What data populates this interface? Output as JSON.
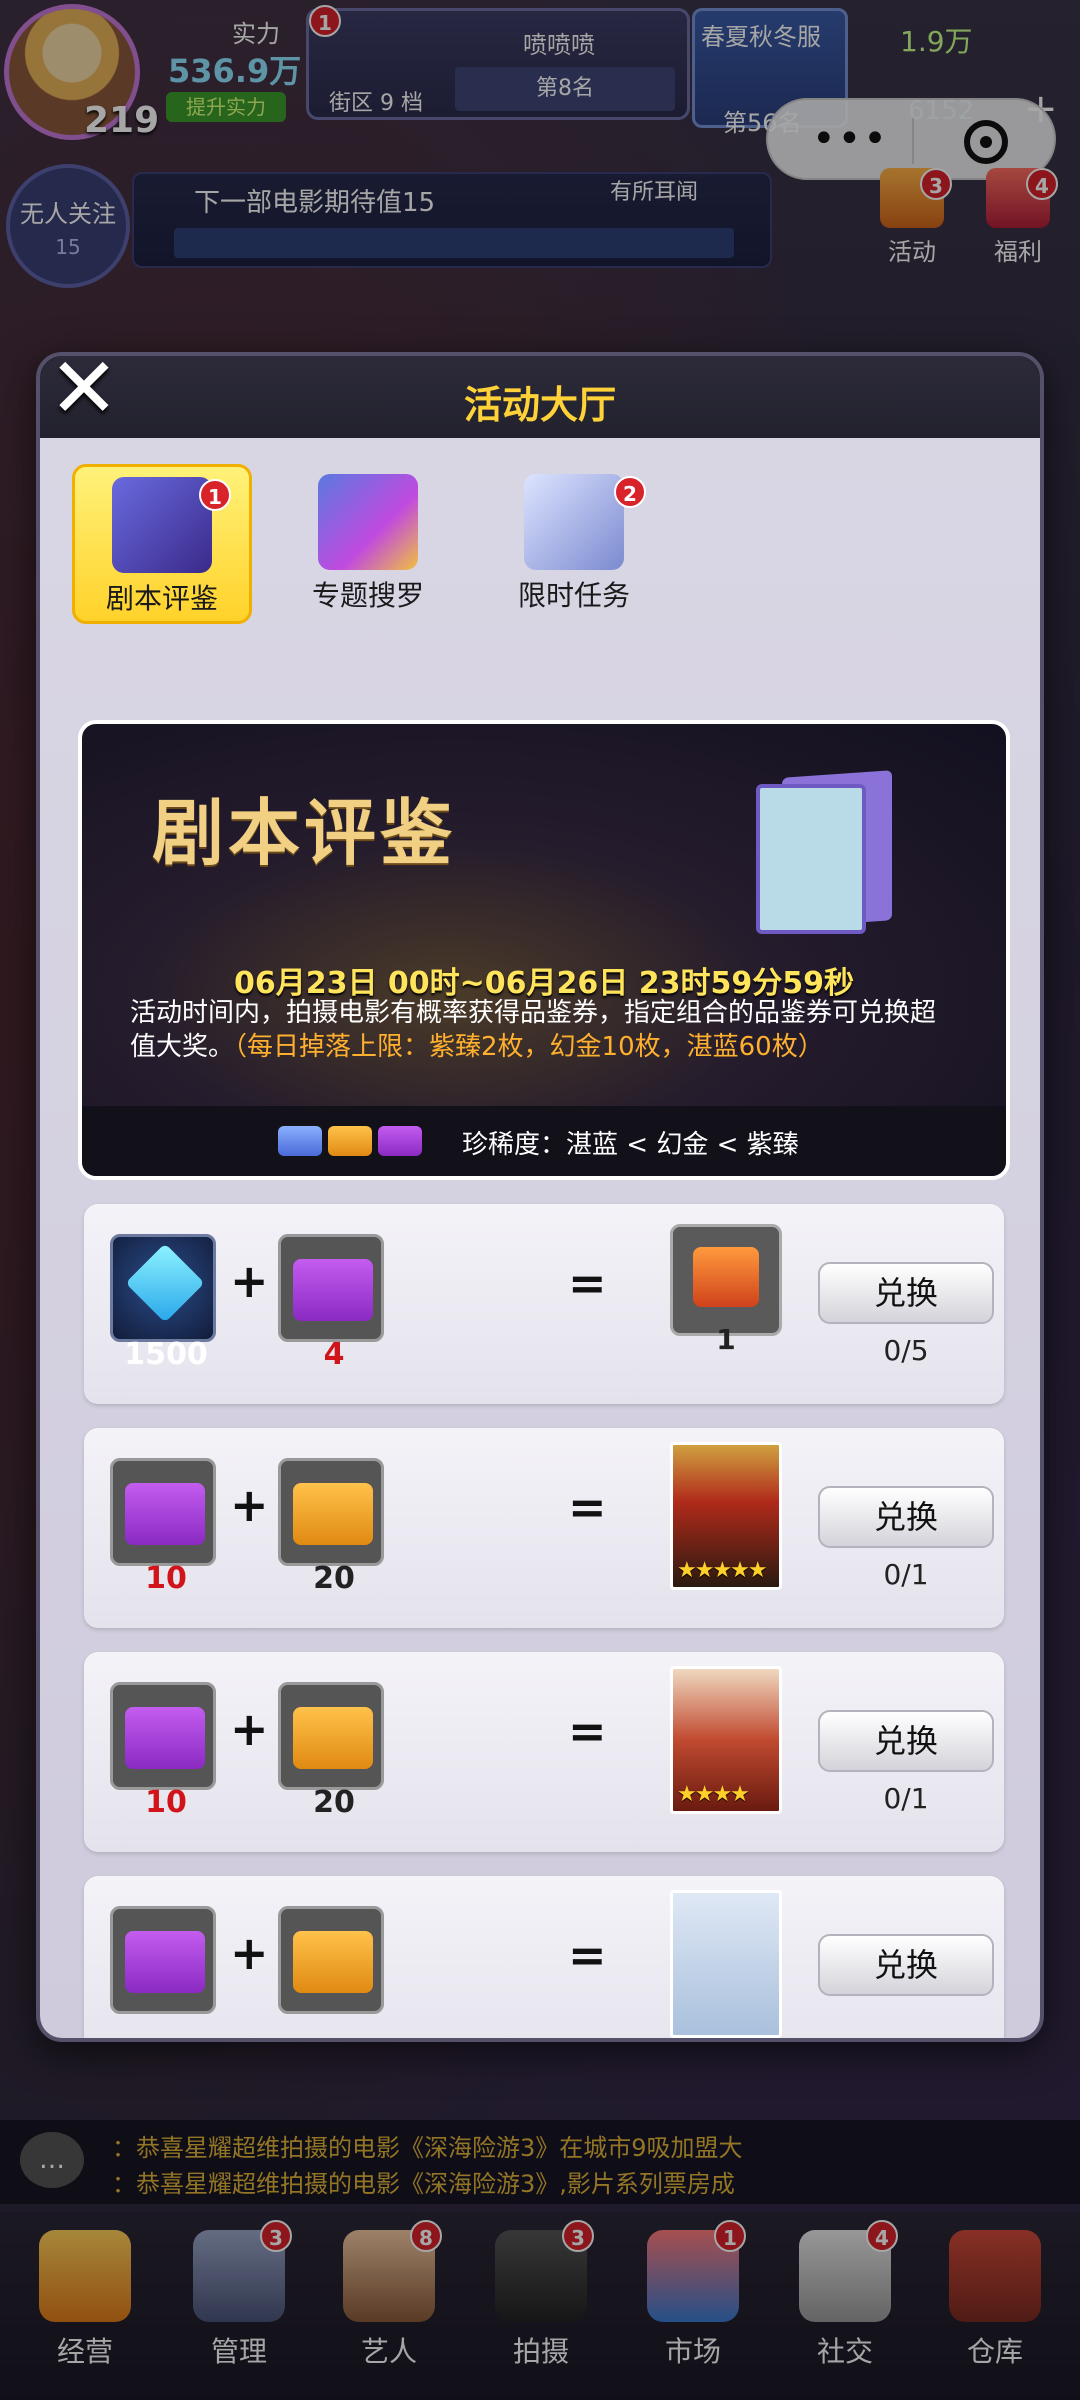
{
  "topbar": {
    "power_label": "实力",
    "power_value": "536.9万",
    "upgrade_label": "提升实力",
    "level": "219",
    "district_badge": "1",
    "district_name": "喷喷喷",
    "district_level": "街区 9 档",
    "district_rank": "第8名",
    "season_title": "春夏秋冬服",
    "season_rank": "第56名",
    "coins": "1.9万",
    "gems": "6152",
    "plus": "+"
  },
  "follow": {
    "label": "无人关注",
    "count": "15"
  },
  "expectation": {
    "text": "下一部电影期待值15",
    "tag": "有所耳闻"
  },
  "side_icons": [
    {
      "label": "活动",
      "badge": "3"
    },
    {
      "label": "福利",
      "badge": "4"
    }
  ],
  "modal": {
    "title": "活动大厅",
    "close": "✕",
    "tabs": [
      {
        "label": "剧本评鉴",
        "badge": "1"
      },
      {
        "label": "专题搜罗",
        "badge": ""
      },
      {
        "label": "限时任务",
        "badge": "2"
      }
    ],
    "banner": {
      "title": "剧本评鉴",
      "time": "06月23日 00时~06月26日 23时59分59秒",
      "desc": "活动时间内，拍摄电影有概率获得品鉴券，指定组合的品鉴券可兑换超值大奖。",
      "desc_highlight": "（每日掉落上限：紫臻2枚，幻金10枚，湛蓝60枚）",
      "rarity": "珍稀度：湛蓝 < 幻金 < 紫臻"
    },
    "exchange_label": "兑换",
    "rows": [
      {
        "a_qty": "1500",
        "b_qty": "4",
        "reward_qty": "1",
        "count": "0/5"
      },
      {
        "a_qty": "10",
        "b_qty": "20",
        "reward_qty": "",
        "count": "0/1"
      },
      {
        "a_qty": "10",
        "b_qty": "20",
        "reward_qty": "",
        "count": "0/1"
      },
      {
        "a_qty": "",
        "b_qty": "",
        "reward_qty": "",
        "count": ""
      }
    ]
  },
  "ticker": {
    "line1": "：恭喜星耀超维拍摄的电影《深海险游3》在城市9吸加盟大",
    "line2": "：恭喜星耀超维拍摄的电影《深海险游3》,影片系列票房成"
  },
  "nav": [
    {
      "label": "经营",
      "badge": ""
    },
    {
      "label": "管理",
      "badge": "3"
    },
    {
      "label": "艺人",
      "badge": "8"
    },
    {
      "label": "拍摄",
      "badge": "3"
    },
    {
      "label": "市场",
      "badge": "1"
    },
    {
      "label": "社交",
      "badge": "4"
    },
    {
      "label": "仓库",
      "badge": ""
    }
  ],
  "colors": {
    "modal_title": "#ffd238",
    "banner_time": "#ffe45c",
    "highlight": "#ffb02e",
    "short_qty": "#d0141a",
    "badge": "#d8232a"
  }
}
